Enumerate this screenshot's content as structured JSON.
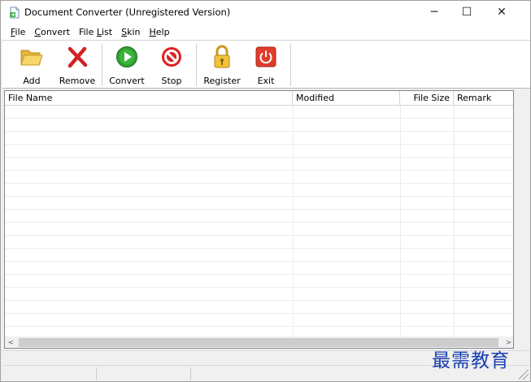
{
  "window": {
    "title": "Document Converter (Unregistered Version)",
    "icon": "document-app-icon",
    "caption_buttons": {
      "minimize": "─",
      "maximize": "☐",
      "close": "✕"
    }
  },
  "menu": {
    "items": [
      {
        "name": "file",
        "accel": "F",
        "rest": "ile"
      },
      {
        "name": "convert",
        "accel": "C",
        "rest": "onvert"
      },
      {
        "name": "file-list",
        "pre": "File ",
        "accel": "L",
        "rest": "ist"
      },
      {
        "name": "skin",
        "accel": "S",
        "rest": "kin"
      },
      {
        "name": "help",
        "accel": "H",
        "rest": "elp"
      }
    ]
  },
  "toolbar": {
    "add": "Add",
    "remove": "Remove",
    "convert": "Convert",
    "stop": "Stop",
    "register": "Register",
    "exit": "Exit"
  },
  "colors": {
    "add_icon": "#f2c94c",
    "remove_icon": "#d42020",
    "convert_icon": "#2e9e2e",
    "stop_icon": "#e02020",
    "register_icon": "#e8b830",
    "exit_icon": "#e03c2c",
    "watermark": "#1a3fb0"
  },
  "list": {
    "columns": {
      "file_name": "File Name",
      "modified": "Modified",
      "file_size": "File Size",
      "remark": "Remark"
    },
    "rows": []
  },
  "scrollbar": {
    "left_arrow": "<",
    "right_arrow": ">"
  },
  "watermark": "最需教育"
}
